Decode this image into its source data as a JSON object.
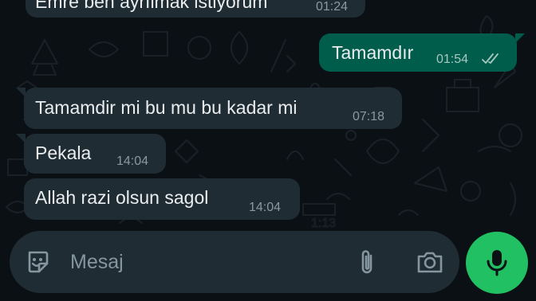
{
  "chat": {
    "messages": [
      {
        "direction": "in",
        "text": "Emre ben ayrılmak istiyorum",
        "time": "01:24"
      },
      {
        "direction": "out",
        "text": "Tamamdır",
        "time": "01:54",
        "status": "read"
      },
      {
        "direction": "in",
        "text": "Tamamdir mi bu mu bu kadar mi",
        "time": "07:18"
      },
      {
        "direction": "in",
        "text": "Pekala",
        "time": "14:04"
      },
      {
        "direction": "in",
        "text": "Allah razi olsun sagol",
        "time": "14:04"
      }
    ],
    "wallpaper_time_doodle": "1:13"
  },
  "composer": {
    "placeholder": "Mesaj",
    "emoji_icon": "sticker-smiley-icon",
    "attach_icon": "paperclip-icon",
    "camera_icon": "camera-icon",
    "mic_icon": "microphone-icon"
  },
  "colors": {
    "background": "#0b1014",
    "incoming_bubble": "#202c33",
    "outgoing_bubble": "#005c4b",
    "accent_green": "#21c063",
    "text": "#e9edef",
    "muted_text": "#8696a0"
  }
}
